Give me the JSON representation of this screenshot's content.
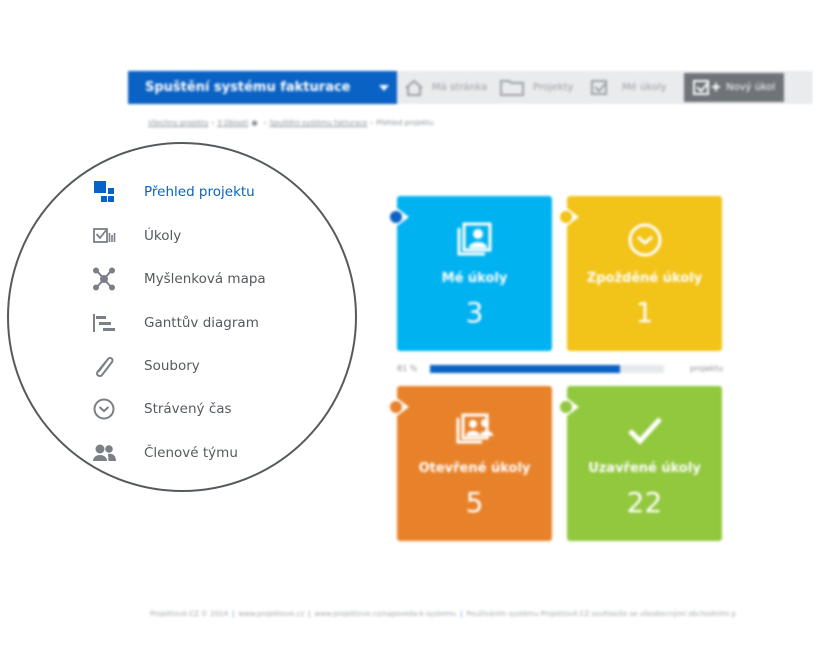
{
  "topbar": {
    "project_select": "Spuštění systému fakturace",
    "nav": [
      {
        "label": "Má stránka",
        "icon": "home-icon"
      },
      {
        "label": "Projekty",
        "icon": "folder-icon"
      },
      {
        "label": "Mé úkoly",
        "icon": "tasks-icon"
      }
    ],
    "new_task_label": "Nový úkol",
    "new_task_icon": "add-task-icon"
  },
  "breadcrumb": {
    "items": [
      "Všechny projekty",
      "3 Oblasti",
      "Spuštění systému fakturace"
    ],
    "current": "Přehled projektu"
  },
  "menu": {
    "items": [
      {
        "label": "Přehled projektu",
        "icon": "dashboard-icon",
        "active": true
      },
      {
        "label": "Úkoly",
        "icon": "tasks-icon",
        "active": false
      },
      {
        "label": "Myšlenková mapa",
        "icon": "mindmap-icon",
        "active": false
      },
      {
        "label": "Ganttův diagram",
        "icon": "gantt-icon",
        "active": false
      },
      {
        "label": "Soubory",
        "icon": "paperclip-icon",
        "active": false
      },
      {
        "label": "Strávený čas",
        "icon": "clock-icon",
        "active": false
      },
      {
        "label": "Členové týmu",
        "icon": "team-icon",
        "active": false
      }
    ]
  },
  "tiles": [
    {
      "label": "Mé úkoly",
      "count": "3",
      "color": "#00b2f0",
      "dot_color": "#0a62c4",
      "icon": "my-tasks-icon"
    },
    {
      "label": "Zpožděné úkoly",
      "count": "1",
      "color": "#f2c318",
      "dot_color": "#f2c318",
      "icon": "clock-icon"
    },
    {
      "label": "Otevřené úkoly",
      "count": "5",
      "color": "#e8822a",
      "dot_color": "#e8822a",
      "icon": "open-tasks-icon"
    },
    {
      "label": "Uzavřené úkoly",
      "count": "22",
      "color": "#92c83e",
      "dot_color": "#92c83e",
      "icon": "check-icon"
    }
  ],
  "progress": {
    "percent_label": "81 %",
    "value": 0.81,
    "suffix": "projektu"
  },
  "footer": {
    "items": [
      "Projektově.CZ © 2014",
      "www.projektove.cz",
      "www.projektove.cz/napoveda-k-systemu",
      "Používáním systému Projektově.CZ souhlasíte se všeobecnými obchodními p"
    ]
  }
}
